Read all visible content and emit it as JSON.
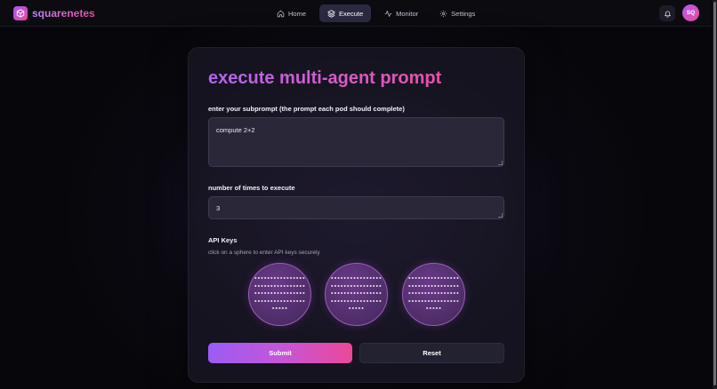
{
  "app": {
    "name": "squarenetes",
    "accent_color": "#c056e0",
    "logo_icon": "cube-icon"
  },
  "nav": {
    "items": [
      {
        "label": "Home",
        "icon": "home-icon",
        "active": false
      },
      {
        "label": "Execute",
        "icon": "layers-icon",
        "active": true
      },
      {
        "label": "Monitor",
        "icon": "activity-icon",
        "active": false
      },
      {
        "label": "Settings",
        "icon": "gear-icon",
        "active": false
      }
    ],
    "notifications_icon": "bell-icon",
    "avatar_initials": "SQ"
  },
  "form": {
    "title": "execute multi-agent prompt",
    "subprompt": {
      "label": "enter your subprompt (the prompt each pod should complete)",
      "value": "compute 2+2"
    },
    "times": {
      "label": "number of times to execute",
      "value": "3"
    },
    "api_keys": {
      "label": "API Keys",
      "hint": "click on a sphere to enter API keys securely",
      "spheres": [
        {
          "masked_lines": [
            "••••••••••••••••",
            "••••••••••••••••",
            "••••••••••••••••",
            "••••••••••••••••",
            "•••••"
          ]
        },
        {
          "masked_lines": [
            "••••••••••••••••",
            "••••••••••••••••",
            "••••••••••••••••",
            "••••••••••••••••",
            "•••••"
          ]
        },
        {
          "masked_lines": [
            "••••••••••••••••",
            "••••••••••••••••",
            "••••••••••••••••",
            "••••••••••••••••",
            "•••••"
          ]
        }
      ]
    },
    "submit_label": "Submit",
    "reset_label": "Reset"
  }
}
